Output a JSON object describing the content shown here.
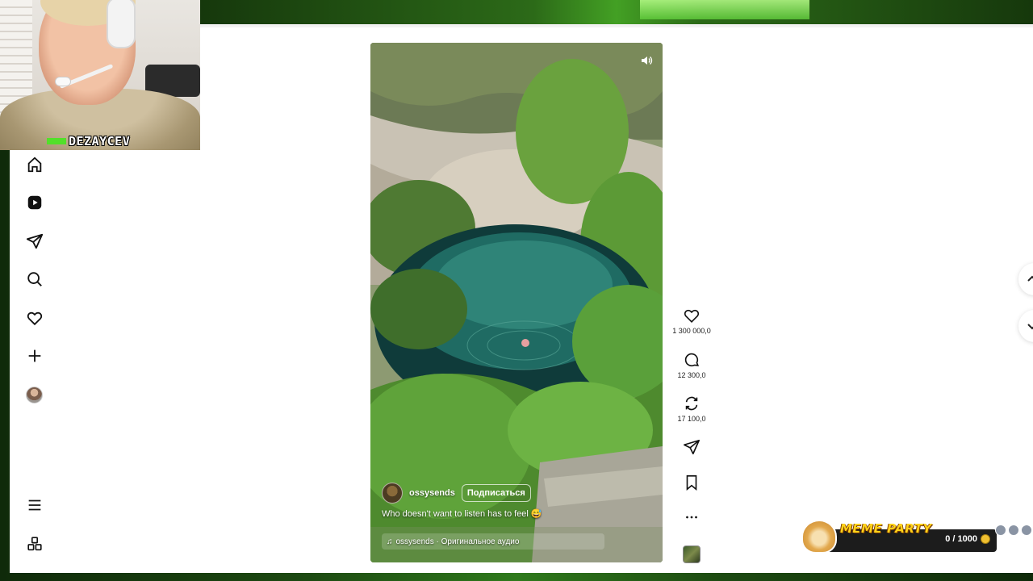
{
  "stream": {
    "streamer_name": "DEZAYCEV"
  },
  "reel": {
    "username": "ossysends",
    "follow_label": "Подписаться",
    "caption": "Who doesn't want to listen has to feel 😅",
    "audio_label": "ossysends · Оригинальное аудио"
  },
  "actions": {
    "likes": "1 300 000,0",
    "comments": "12 300,0",
    "reposts": "17 100,0"
  },
  "sidebar": {
    "items": [
      "home-icon",
      "reels-icon",
      "messages-icon",
      "search-icon",
      "notifications-icon",
      "create-icon",
      "profile-avatar",
      "menu-icon",
      "more-apps-icon"
    ]
  },
  "widget": {
    "title": "MEME PARTY",
    "progress": "0 / 1000"
  },
  "colors": {
    "accent_green": "#52e02a",
    "meme_title": "#ffd21a",
    "background": "#ffffff"
  }
}
